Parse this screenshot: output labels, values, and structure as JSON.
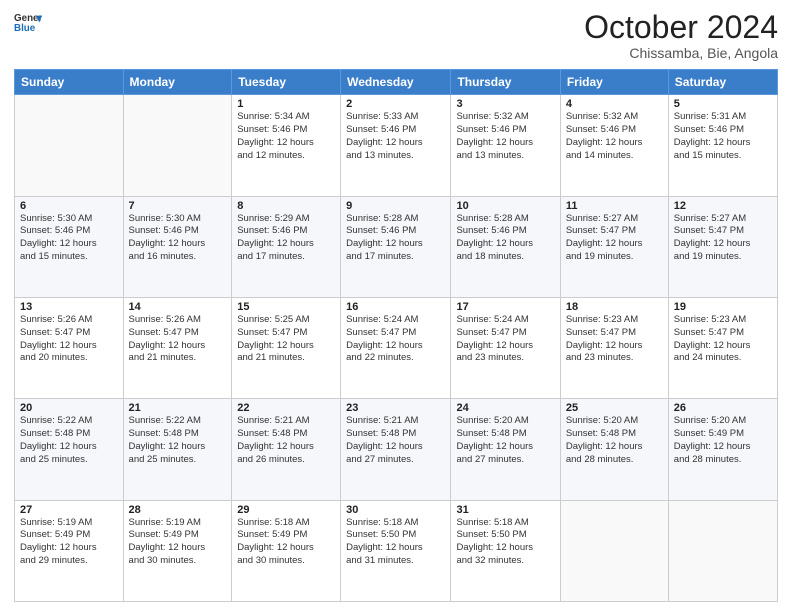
{
  "logo": {
    "line1": "General",
    "line2": "Blue"
  },
  "title": "October 2024",
  "subtitle": "Chissamba, Bie, Angola",
  "weekdays": [
    "Sunday",
    "Monday",
    "Tuesday",
    "Wednesday",
    "Thursday",
    "Friday",
    "Saturday"
  ],
  "weeks": [
    [
      {
        "day": "",
        "info": ""
      },
      {
        "day": "",
        "info": ""
      },
      {
        "day": "1",
        "info": "Sunrise: 5:34 AM\nSunset: 5:46 PM\nDaylight: 12 hours\nand 12 minutes."
      },
      {
        "day": "2",
        "info": "Sunrise: 5:33 AM\nSunset: 5:46 PM\nDaylight: 12 hours\nand 13 minutes."
      },
      {
        "day": "3",
        "info": "Sunrise: 5:32 AM\nSunset: 5:46 PM\nDaylight: 12 hours\nand 13 minutes."
      },
      {
        "day": "4",
        "info": "Sunrise: 5:32 AM\nSunset: 5:46 PM\nDaylight: 12 hours\nand 14 minutes."
      },
      {
        "day": "5",
        "info": "Sunrise: 5:31 AM\nSunset: 5:46 PM\nDaylight: 12 hours\nand 15 minutes."
      }
    ],
    [
      {
        "day": "6",
        "info": "Sunrise: 5:30 AM\nSunset: 5:46 PM\nDaylight: 12 hours\nand 15 minutes."
      },
      {
        "day": "7",
        "info": "Sunrise: 5:30 AM\nSunset: 5:46 PM\nDaylight: 12 hours\nand 16 minutes."
      },
      {
        "day": "8",
        "info": "Sunrise: 5:29 AM\nSunset: 5:46 PM\nDaylight: 12 hours\nand 17 minutes."
      },
      {
        "day": "9",
        "info": "Sunrise: 5:28 AM\nSunset: 5:46 PM\nDaylight: 12 hours\nand 17 minutes."
      },
      {
        "day": "10",
        "info": "Sunrise: 5:28 AM\nSunset: 5:46 PM\nDaylight: 12 hours\nand 18 minutes."
      },
      {
        "day": "11",
        "info": "Sunrise: 5:27 AM\nSunset: 5:47 PM\nDaylight: 12 hours\nand 19 minutes."
      },
      {
        "day": "12",
        "info": "Sunrise: 5:27 AM\nSunset: 5:47 PM\nDaylight: 12 hours\nand 19 minutes."
      }
    ],
    [
      {
        "day": "13",
        "info": "Sunrise: 5:26 AM\nSunset: 5:47 PM\nDaylight: 12 hours\nand 20 minutes."
      },
      {
        "day": "14",
        "info": "Sunrise: 5:26 AM\nSunset: 5:47 PM\nDaylight: 12 hours\nand 21 minutes."
      },
      {
        "day": "15",
        "info": "Sunrise: 5:25 AM\nSunset: 5:47 PM\nDaylight: 12 hours\nand 21 minutes."
      },
      {
        "day": "16",
        "info": "Sunrise: 5:24 AM\nSunset: 5:47 PM\nDaylight: 12 hours\nand 22 minutes."
      },
      {
        "day": "17",
        "info": "Sunrise: 5:24 AM\nSunset: 5:47 PM\nDaylight: 12 hours\nand 23 minutes."
      },
      {
        "day": "18",
        "info": "Sunrise: 5:23 AM\nSunset: 5:47 PM\nDaylight: 12 hours\nand 23 minutes."
      },
      {
        "day": "19",
        "info": "Sunrise: 5:23 AM\nSunset: 5:47 PM\nDaylight: 12 hours\nand 24 minutes."
      }
    ],
    [
      {
        "day": "20",
        "info": "Sunrise: 5:22 AM\nSunset: 5:48 PM\nDaylight: 12 hours\nand 25 minutes."
      },
      {
        "day": "21",
        "info": "Sunrise: 5:22 AM\nSunset: 5:48 PM\nDaylight: 12 hours\nand 25 minutes."
      },
      {
        "day": "22",
        "info": "Sunrise: 5:21 AM\nSunset: 5:48 PM\nDaylight: 12 hours\nand 26 minutes."
      },
      {
        "day": "23",
        "info": "Sunrise: 5:21 AM\nSunset: 5:48 PM\nDaylight: 12 hours\nand 27 minutes."
      },
      {
        "day": "24",
        "info": "Sunrise: 5:20 AM\nSunset: 5:48 PM\nDaylight: 12 hours\nand 27 minutes."
      },
      {
        "day": "25",
        "info": "Sunrise: 5:20 AM\nSunset: 5:48 PM\nDaylight: 12 hours\nand 28 minutes."
      },
      {
        "day": "26",
        "info": "Sunrise: 5:20 AM\nSunset: 5:49 PM\nDaylight: 12 hours\nand 28 minutes."
      }
    ],
    [
      {
        "day": "27",
        "info": "Sunrise: 5:19 AM\nSunset: 5:49 PM\nDaylight: 12 hours\nand 29 minutes."
      },
      {
        "day": "28",
        "info": "Sunrise: 5:19 AM\nSunset: 5:49 PM\nDaylight: 12 hours\nand 30 minutes."
      },
      {
        "day": "29",
        "info": "Sunrise: 5:18 AM\nSunset: 5:49 PM\nDaylight: 12 hours\nand 30 minutes."
      },
      {
        "day": "30",
        "info": "Sunrise: 5:18 AM\nSunset: 5:50 PM\nDaylight: 12 hours\nand 31 minutes."
      },
      {
        "day": "31",
        "info": "Sunrise: 5:18 AM\nSunset: 5:50 PM\nDaylight: 12 hours\nand 32 minutes."
      },
      {
        "day": "",
        "info": ""
      },
      {
        "day": "",
        "info": ""
      }
    ]
  ]
}
